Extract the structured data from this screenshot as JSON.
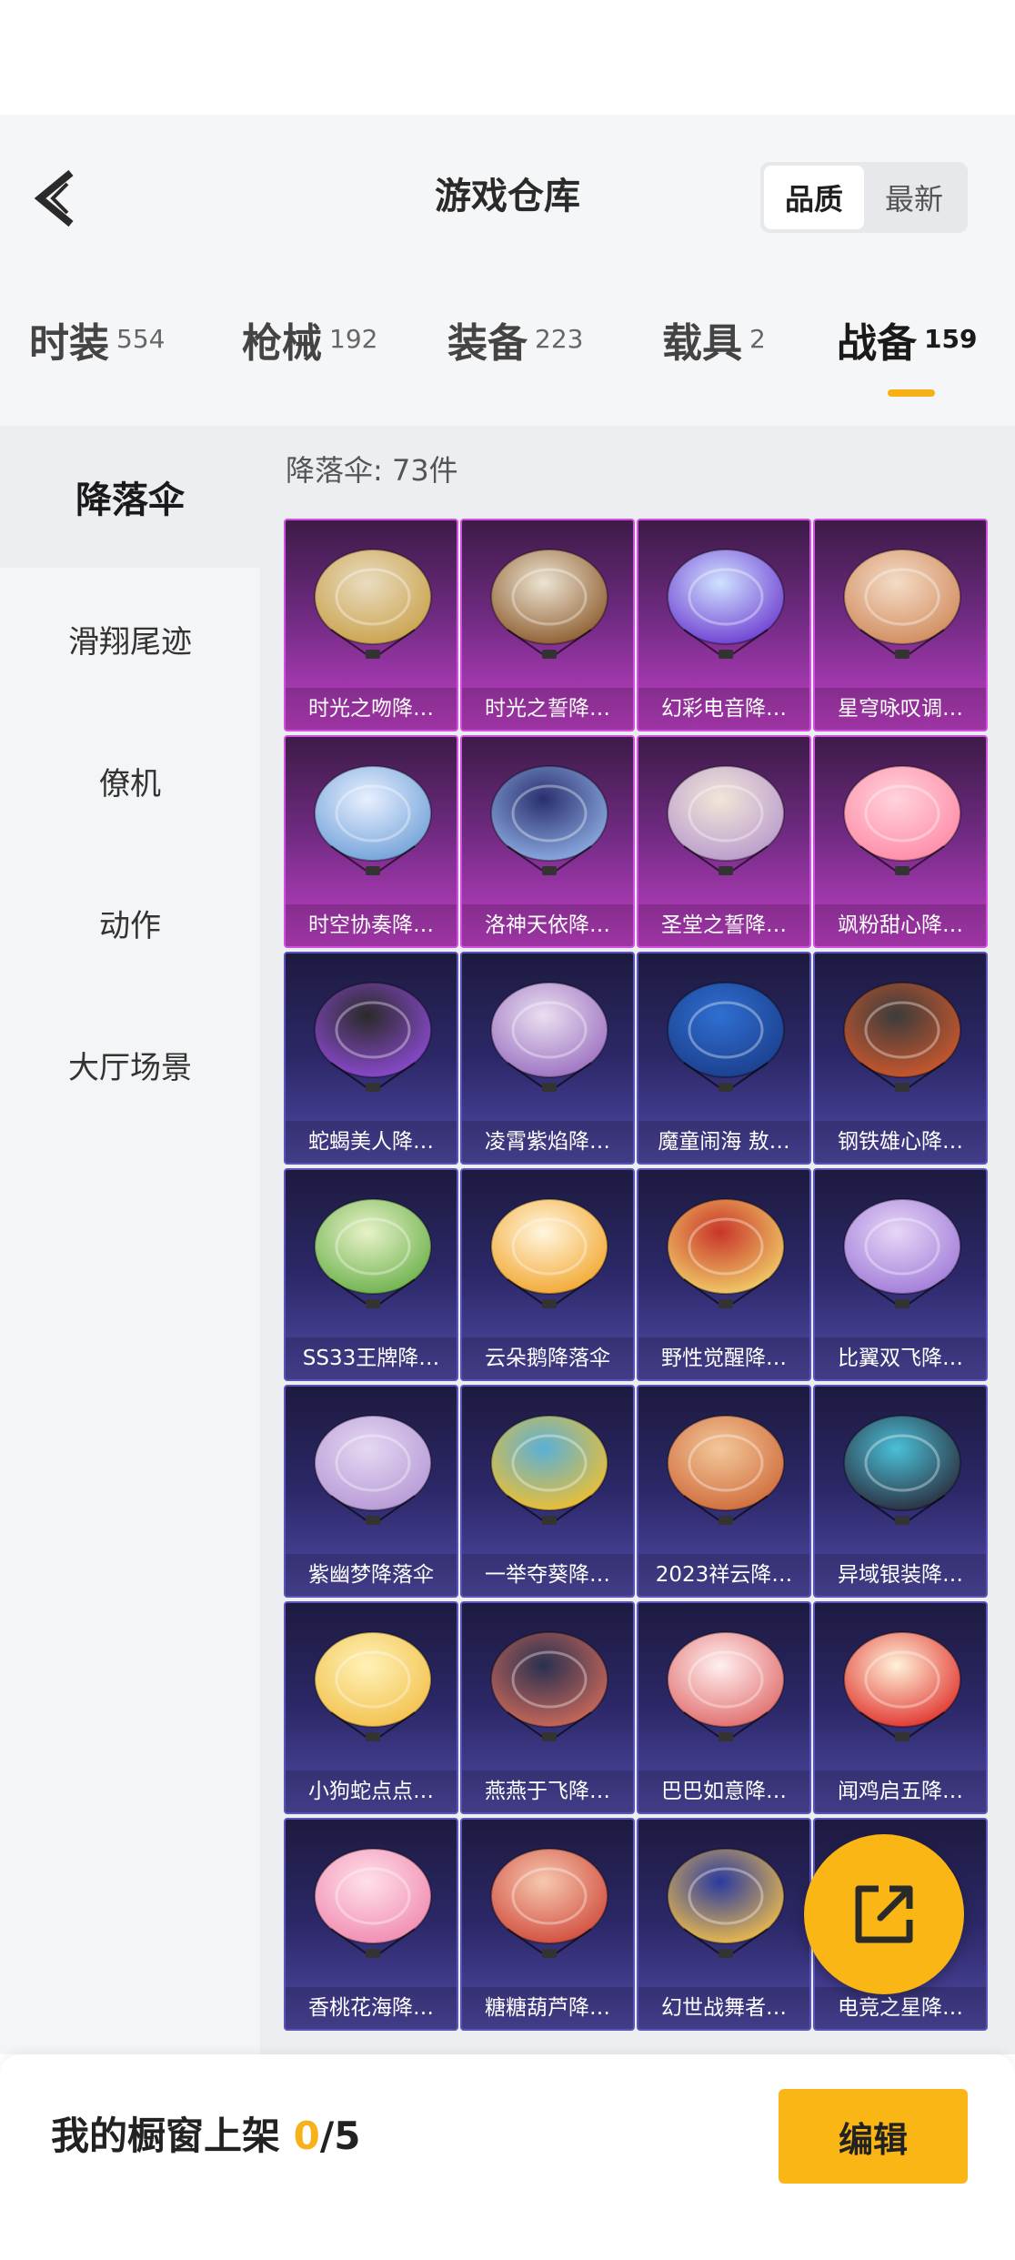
{
  "header": {
    "title": "游戏仓库",
    "sort_options": [
      "品质",
      "最新"
    ],
    "sort_selected": "品质"
  },
  "tabs": [
    {
      "label": "时装",
      "count": "554"
    },
    {
      "label": "枪械",
      "count": "192"
    },
    {
      "label": "装备",
      "count": "223"
    },
    {
      "label": "载具",
      "count": "2"
    },
    {
      "label": "战备",
      "count": "159",
      "active": true
    }
  ],
  "sidebar": {
    "items": [
      {
        "label": "降落伞",
        "active": true
      },
      {
        "label": "滑翔尾迹"
      },
      {
        "label": "僚机"
      },
      {
        "label": "动作"
      },
      {
        "label": "大厅场景"
      }
    ]
  },
  "grid": {
    "header": "降落伞: 73件",
    "items": [
      {
        "name": "时光之吻降…",
        "rarity": "purple",
        "colors": [
          "#e9dcc0",
          "#c9a14a"
        ]
      },
      {
        "name": "时光之誓降…",
        "rarity": "purple",
        "colors": [
          "#ece4d2",
          "#8c5a2c"
        ]
      },
      {
        "name": "幻彩电音降…",
        "rarity": "purple",
        "colors": [
          "#cfe2ff",
          "#6c3bd1"
        ]
      },
      {
        "name": "星穹咏叹调…",
        "rarity": "purple",
        "colors": [
          "#f4dcc6",
          "#d08a5c"
        ]
      },
      {
        "name": "时空协奏降…",
        "rarity": "purple",
        "colors": [
          "#e8f0ff",
          "#6fa0d8"
        ]
      },
      {
        "name": "洛神天依降…",
        "rarity": "purple",
        "colors": [
          "#2a2f6e",
          "#8fb0e6"
        ]
      },
      {
        "name": "圣堂之誓降…",
        "rarity": "purple",
        "colors": [
          "#f2e6d8",
          "#b89acc"
        ]
      },
      {
        "name": "飒粉甜心降…",
        "rarity": "purple",
        "colors": [
          "#ffd3dc",
          "#ff8aa6"
        ]
      },
      {
        "name": "蛇蝎美人降…",
        "rarity": "blue",
        "colors": [
          "#2a2a2a",
          "#8e4bd6"
        ]
      },
      {
        "name": "凌霄紫焰降…",
        "rarity": "blue",
        "colors": [
          "#eadff0",
          "#9a6fc0"
        ]
      },
      {
        "name": "魔童闹海 敖…",
        "rarity": "blue",
        "colors": [
          "#2f6fd1",
          "#1b3e8c"
        ]
      },
      {
        "name": "钢铁雄心降…",
        "rarity": "blue",
        "colors": [
          "#3c3c3c",
          "#d0582c"
        ]
      },
      {
        "name": "SS33王牌降…",
        "rarity": "blue",
        "colors": [
          "#e8f2c8",
          "#6ab04a"
        ]
      },
      {
        "name": "云朵鹅降落伞",
        "rarity": "blue",
        "colors": [
          "#fff6e0",
          "#f2a62c"
        ]
      },
      {
        "name": "野性觉醒降…",
        "rarity": "blue",
        "colors": [
          "#c9352a",
          "#f2d26a"
        ]
      },
      {
        "name": "比翼双飞降…",
        "rarity": "blue",
        "colors": [
          "#e6d6f6",
          "#a07ad8"
        ]
      },
      {
        "name": "紫幽梦降落伞",
        "rarity": "blue",
        "colors": [
          "#e4d8f2",
          "#b698d6"
        ]
      },
      {
        "name": "一举夺葵降…",
        "rarity": "blue",
        "colors": [
          "#5ab0d8",
          "#f2c02c"
        ]
      },
      {
        "name": "2023祥云降…",
        "rarity": "blue",
        "colors": [
          "#f2c89a",
          "#d06a3a"
        ]
      },
      {
        "name": "异域银装降…",
        "rarity": "blue",
        "colors": [
          "#4ac0d8",
          "#2a2a3a"
        ]
      },
      {
        "name": "小狗蛇点点…",
        "rarity": "blue",
        "colors": [
          "#fff2b8",
          "#f2c04a"
        ]
      },
      {
        "name": "燕燕于飞降…",
        "rarity": "blue",
        "colors": [
          "#2a3050",
          "#d06a5a"
        ]
      },
      {
        "name": "巴巴如意降…",
        "rarity": "blue",
        "colors": [
          "#fff0f0",
          "#e06a6a"
        ]
      },
      {
        "name": "闻鸡启五降…",
        "rarity": "blue",
        "colors": [
          "#fff2d8",
          "#e0302a"
        ]
      },
      {
        "name": "香桃花海降…",
        "rarity": "blue",
        "colors": [
          "#ffe0ea",
          "#f08ab0"
        ]
      },
      {
        "name": "糖糖葫芦降…",
        "rarity": "blue",
        "colors": [
          "#f6c8b0",
          "#d04a3a"
        ]
      },
      {
        "name": "幻世战舞者…",
        "rarity": "blue",
        "colors": [
          "#2a3aa0",
          "#f2c04a"
        ]
      },
      {
        "name": "电竞之星降…",
        "rarity": "blue",
        "colors": [
          "#f2f2f2",
          "#e03030"
        ]
      }
    ]
  },
  "bottom": {
    "label": "我的橱窗上架 ",
    "current": "0",
    "max": "/5",
    "edit_label": "编辑"
  },
  "icons": {
    "back": "chevron-left-icon",
    "share": "external-link-icon"
  },
  "colors": {
    "accent": "#f9b614",
    "purple_rarity": "#c240c8",
    "blue_rarity": "#514aa6"
  }
}
